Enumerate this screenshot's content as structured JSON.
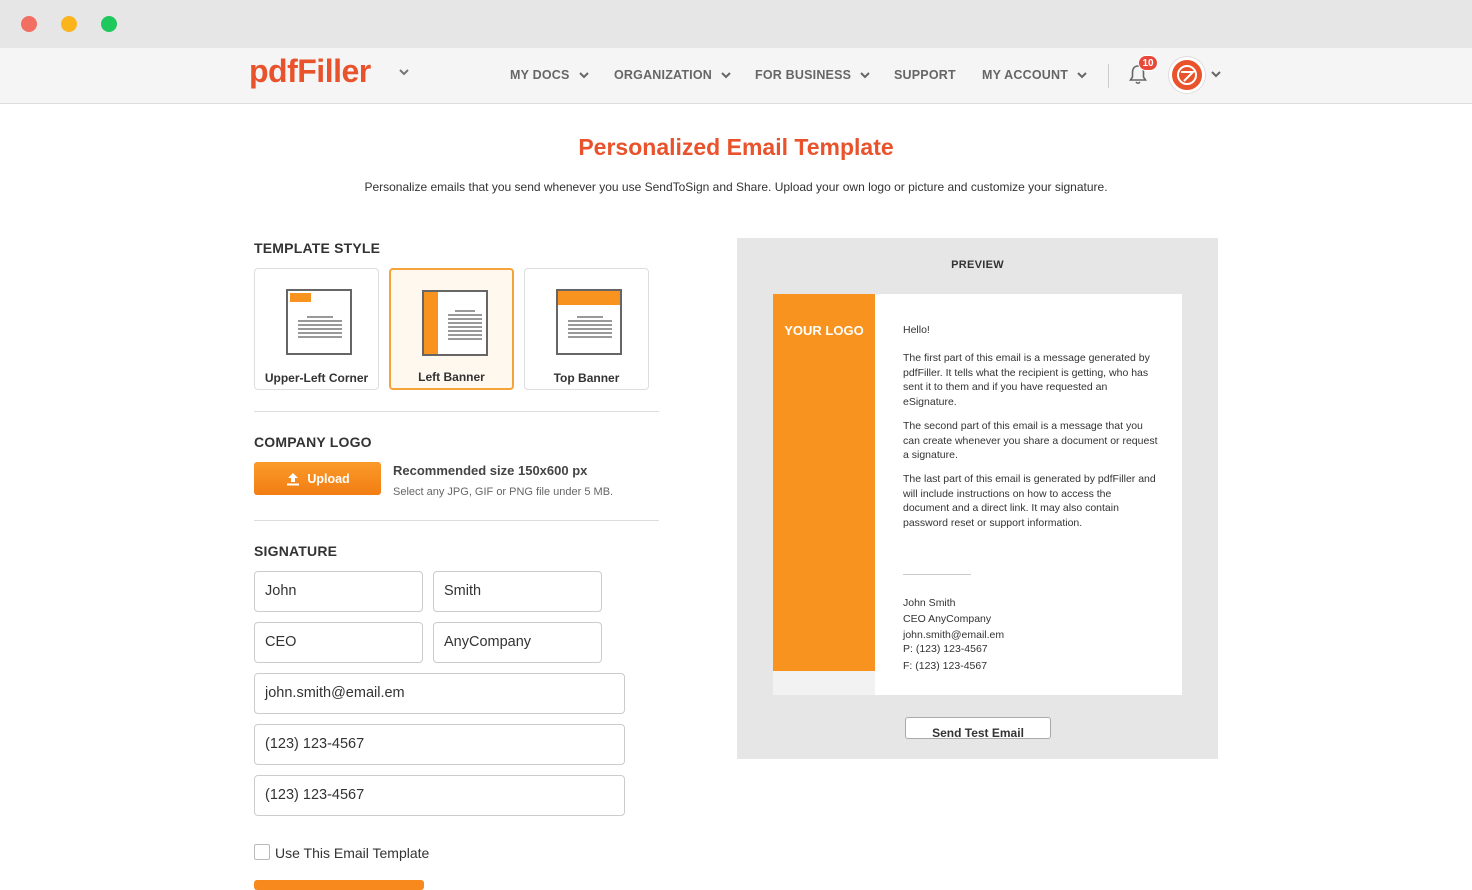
{
  "window": {
    "controls": [
      "close",
      "minimize",
      "maximize"
    ]
  },
  "nav": {
    "brand": "pdfFiller",
    "items": [
      {
        "label": "MY DOCS",
        "dropdown": true
      },
      {
        "label": "ORGANIZATION",
        "dropdown": true
      },
      {
        "label": "FOR BUSINESS",
        "dropdown": true
      },
      {
        "label": "SUPPORT",
        "dropdown": false
      },
      {
        "label": "MY ACCOUNT",
        "dropdown": true
      }
    ],
    "notifications_count": "10",
    "icons": [
      "chevron-down-icon",
      "bell-icon",
      "avatar"
    ]
  },
  "page": {
    "title": "Personalized Email Template",
    "subtitle": "Personalize emails that you send whenever you use SendToSign and Share. Upload your own logo or picture and customize your signature."
  },
  "template_style": {
    "heading": "TEMPLATE STYLE",
    "options": [
      "Upper-Left Corner",
      "Left Banner",
      "Top Banner"
    ],
    "selected": "Left Banner"
  },
  "company_logo": {
    "heading": "COMPANY LOGO",
    "upload_label": "Upload",
    "recommended": "Recommended size 150x600 px",
    "note": "Select any JPG, GIF or PNG file under 5 MB."
  },
  "signature": {
    "heading": "SIGNATURE",
    "first_name": "John",
    "last_name": "Smith",
    "title": "CEO",
    "company": "AnyCompany",
    "email": "john.smith@email.em",
    "phone": "(123) 123-4567",
    "fax": "(123) 123-4567"
  },
  "use_template": {
    "label": "Use This Email Template",
    "checked": false
  },
  "preview": {
    "heading": "PREVIEW",
    "logo_placeholder": "YOUR LOGO",
    "greeting": "Hello!",
    "paragraphs": [
      "The first part of this email is a message generated by pdfFiller. It tells what the recipient is getting, who has sent it to them and if you have requested an eSignature.",
      "The second part of this email is a message that you can create whenever you share a document or request a signature.",
      "The last part of this email is generated by pdfFiller and will include instructions on how to access the document and a direct link. It may also contain password reset or support information."
    ],
    "signature_lines": [
      "John Smith",
      "CEO AnyCompany",
      "john.smith@email.em",
      "P: (123) 123-4567",
      "F: (123) 123-4567"
    ],
    "test_button": "Send Test Email"
  },
  "colors": {
    "brand": "#e8532c",
    "accent": "#f7931e",
    "badge": "#e8483a"
  }
}
